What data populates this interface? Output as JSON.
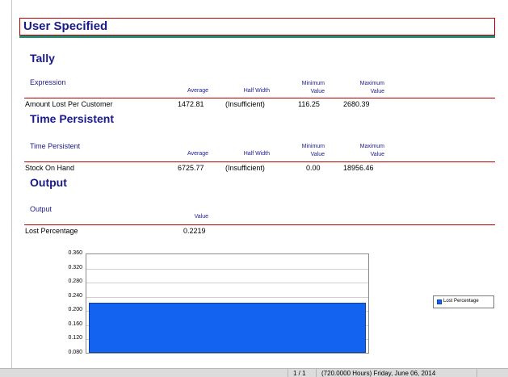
{
  "header": {
    "title": "User Specified"
  },
  "tally": {
    "title": "Tally",
    "columns": {
      "name": "Expression",
      "average": "Average",
      "half_width": "Half Width",
      "min_1": "Minimum",
      "min_2": "Value",
      "max_1": "Maximum",
      "max_2": "Value"
    },
    "row": {
      "name": "Amount Lost Per Customer",
      "average": "1472.81",
      "half_width": "(Insufficient)",
      "min": "116.25",
      "max": "2680.39"
    }
  },
  "time_persistent": {
    "title": "Time Persistent",
    "columns": {
      "name": "Time Persistent",
      "average": "Average",
      "half_width": "Half Width",
      "min_1": "Minimum",
      "min_2": "Value",
      "max_1": "Maximum",
      "max_2": "Value"
    },
    "row": {
      "name": "Stock On Hand",
      "average": "6725.77",
      "half_width": "(Insufficient)",
      "min": "0.00",
      "max": "18956.46"
    }
  },
  "output": {
    "title": "Output",
    "columns": {
      "name": "Output",
      "value": "Value"
    },
    "row": {
      "name": "Lost Percentage",
      "value": "0.2219"
    }
  },
  "chart_data": {
    "type": "bar",
    "categories": [
      "Lost Percentage"
    ],
    "series": [
      {
        "name": "Lost Percentage",
        "values": [
          0.2219
        ]
      }
    ],
    "yticks": [
      "0.360",
      "0.320",
      "0.280",
      "0.240",
      "0.200",
      "0.160",
      "0.120",
      "0.080"
    ],
    "ylim": [
      0.08,
      0.36
    ],
    "legend_position": "right",
    "bar_color": "#1463f0"
  },
  "statusbar": {
    "page": "1 / 1",
    "info": "(720.0000 Hours) Friday, June 06, 2014"
  }
}
